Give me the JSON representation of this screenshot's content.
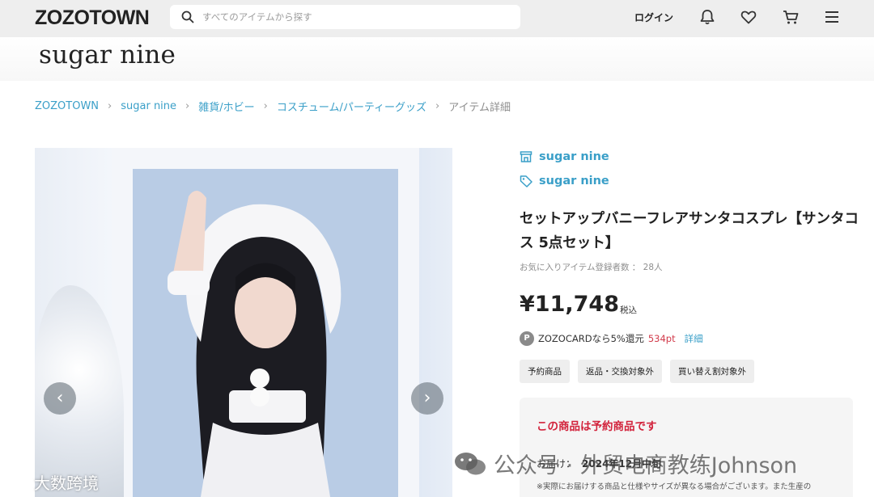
{
  "header": {
    "logo": "ZOZOTOWN",
    "search_placeholder": "すべてのアイテムから探す",
    "login": "ログイン",
    "icons": [
      "bell-icon",
      "heart-icon",
      "cart-icon",
      "menu-icon"
    ]
  },
  "shop": {
    "logo_text": "sugar nine"
  },
  "breadcrumb": [
    "ZOZOTOWN",
    "sugar nine",
    "雑貨/ホビー",
    "コスチューム/パーティーグッズ",
    "アイテム詳細"
  ],
  "product": {
    "shop_name": "sugar nine",
    "brand_name": "sugar nine",
    "title": "セットアップバニーフレアサンタコスプレ【サンタコス 5点セット】",
    "favorites_label": "お気に入りアイテム登録者数 ：",
    "favorites_count": "28人",
    "price": "¥11,748",
    "tax_label": "税込",
    "zozocard_prefix": "ZOZOCARDなら5%還元",
    "zozocard_points": "534pt",
    "zozocard_detail": "詳細",
    "tags": [
      "予約商品",
      "返品・交換対象外",
      "買い替え割対象外"
    ]
  },
  "notice": {
    "title": "この商品は予約商品です",
    "delivery_label": "お届け：",
    "delivery_value": "2024年12月中旬",
    "note": "※実際にお届けする商品と仕様やサイズが異なる場合がございます。また生産の"
  },
  "watermarks": {
    "left": "大数跨境",
    "right": "公众号 · 外贸电商教练Johnson"
  },
  "colors": {
    "accent": "#3a9fc8",
    "alert": "#d2223b",
    "header_bg": "#eeeeee"
  }
}
